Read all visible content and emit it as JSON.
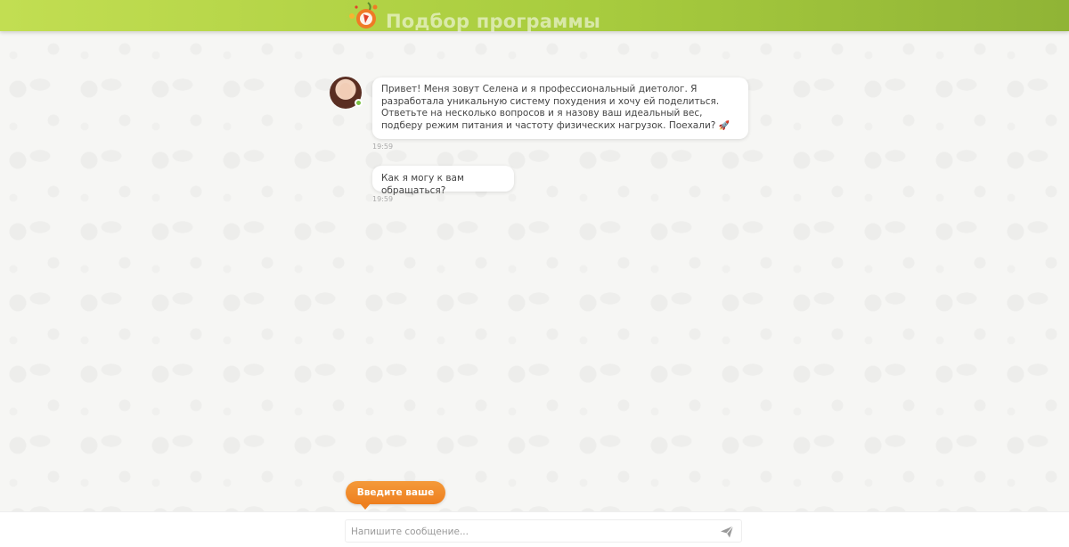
{
  "header": {
    "title": "Подбор программы",
    "logo_icon": "fruit-logo-icon"
  },
  "messages": [
    {
      "text": "Привет! Меня зовут Селена и я профессиональный диетолог. Я разработала уникальную систему похудения и хочу ей поделиться. Ответьте на несколько вопросов и я назову ваш идеальный вес, подберу режим питания и частоту физических нагрузок. Поехали?",
      "emoji": "🚀",
      "time": "19:59"
    },
    {
      "text": "Как я могу к вам обращаться?",
      "time": "19:59"
    }
  ],
  "hint": {
    "label": "Введите ваше имя"
  },
  "composer": {
    "placeholder": "Напишите сообщение...",
    "value": "",
    "send_icon": "send-icon"
  },
  "colors": {
    "header_start": "#c2de52",
    "header_end": "#90b436",
    "hint_orange": "#ee7f1f",
    "online_green": "#7ac143"
  }
}
